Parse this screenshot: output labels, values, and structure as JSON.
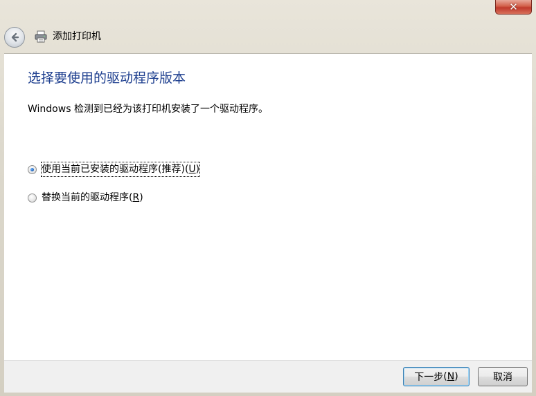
{
  "window": {
    "title": "添加打印机",
    "close_glyph": "✕"
  },
  "icons": {
    "back": "back-arrow-icon",
    "printer": "printer-icon",
    "close": "close-icon"
  },
  "page": {
    "heading": "选择要使用的驱动程序版本",
    "description": "Windows 检测到已经为该打印机安装了一个驱动程序。"
  },
  "options": [
    {
      "label": "使用当前已安装的驱动程序(推荐)",
      "accel": "U",
      "selected": true
    },
    {
      "label": "替换当前的驱动程序",
      "accel": "R",
      "selected": false
    }
  ],
  "buttons": {
    "next": {
      "label": "下一步",
      "accel": "N"
    },
    "cancel": {
      "label": "取消"
    }
  },
  "colors": {
    "heading": "#1e3f8f",
    "close_button": "#c0392b"
  }
}
